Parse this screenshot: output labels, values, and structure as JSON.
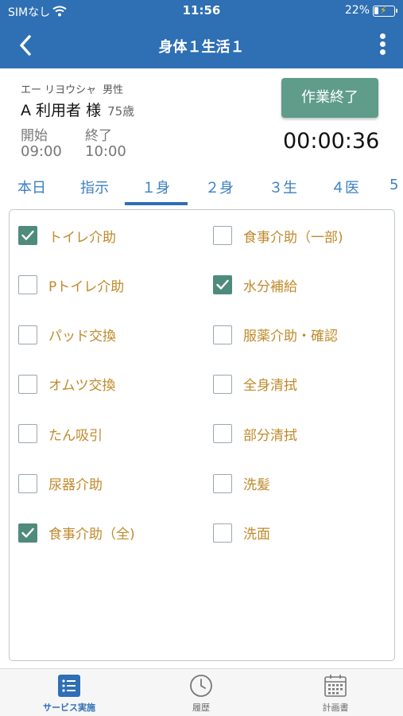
{
  "status_bar": {
    "carrier": "SIMなし",
    "time": "11:56",
    "battery_percent": "22%",
    "battery_level": 0.22
  },
  "header": {
    "title": "身体１生活１",
    "back_icon": "chevron-left-icon",
    "more_icon": "more-vertical-icon"
  },
  "user": {
    "kana": "エー リヨウシャ",
    "gender": "男性",
    "name": "A 利用者 様",
    "age": "75歳"
  },
  "schedule": {
    "start_label": "開始",
    "start_time": "09:00",
    "end_label": "終了",
    "end_time": "10:00"
  },
  "finish_button": "作業終了",
  "timer": "00:00:36",
  "tabs": [
    {
      "label": "本日"
    },
    {
      "label": "指示"
    },
    {
      "label": "１身"
    },
    {
      "label": "２身"
    },
    {
      "label": "３生"
    },
    {
      "label": "４医"
    },
    {
      "label": "5"
    }
  ],
  "active_tab": "１身",
  "checklist": {
    "left": [
      {
        "label": "トイレ介助",
        "checked": true
      },
      {
        "label": "Pトイレ介助",
        "checked": false
      },
      {
        "label": "パッド交換",
        "checked": false
      },
      {
        "label": "オムツ交換",
        "checked": false
      },
      {
        "label": "たん吸引",
        "checked": false
      },
      {
        "label": "尿器介助",
        "checked": false
      },
      {
        "label": "食事介助（全)",
        "checked": true
      }
    ],
    "right": [
      {
        "label": "食事介助（一部)",
        "checked": false
      },
      {
        "label": "水分補給",
        "checked": true
      },
      {
        "label": "服薬介助・確認",
        "checked": false
      },
      {
        "label": "全身清拭",
        "checked": false
      },
      {
        "label": "部分清拭",
        "checked": false
      },
      {
        "label": "洗髪",
        "checked": false
      },
      {
        "label": "洗面",
        "checked": false
      }
    ]
  },
  "bottom_tabs": [
    {
      "label": "サービス実施",
      "icon": "list-icon",
      "active": true
    },
    {
      "label": "履歴",
      "icon": "clock-icon",
      "active": false
    },
    {
      "label": "計画書",
      "icon": "calendar-icon",
      "active": false
    }
  ],
  "colors": {
    "header_blue": "#2f6fb4",
    "tab_blue": "#3a7fc4",
    "finish_green": "#5f9c8a",
    "checkbox_green": "#4f8b7c",
    "item_label_gold": "#c08a2b"
  }
}
